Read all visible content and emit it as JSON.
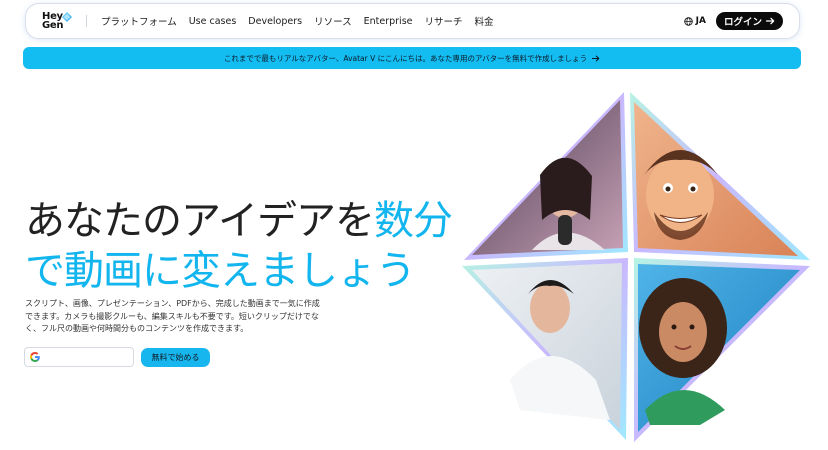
{
  "nav": {
    "logo_line1": "Hey",
    "logo_line2": "Gen",
    "items": [
      "プラットフォーム",
      "Use cases",
      "Developers",
      "リソース",
      "Enterprise",
      "リサーチ",
      "料金"
    ],
    "lang_label": "JA",
    "login_label": "ログイン"
  },
  "banner": {
    "text": "これまでで最もリアルなアバター、Avatar V にこんにちは。あなた専用のアバターを無料で作成しましょう"
  },
  "hero": {
    "title_part1": "あなたのアイデアを",
    "title_accent1": "数分",
    "title_accent2": "で動画に変えましょう",
    "description": "スクリプト、画像、プレゼンテーション、PDFから、完成した動画まで一気に作成できます。カメラも撮影クルーも、編集スキルも不要です。短いクリップだけでなく、フル尺の動画や何時間分ものコンテンツを作成できます。",
    "cta_label": "無料で始める"
  },
  "colors": {
    "accent": "#12b5ee",
    "banner_bg": "#13bdf2",
    "login_bg": "#0b0b0b"
  }
}
